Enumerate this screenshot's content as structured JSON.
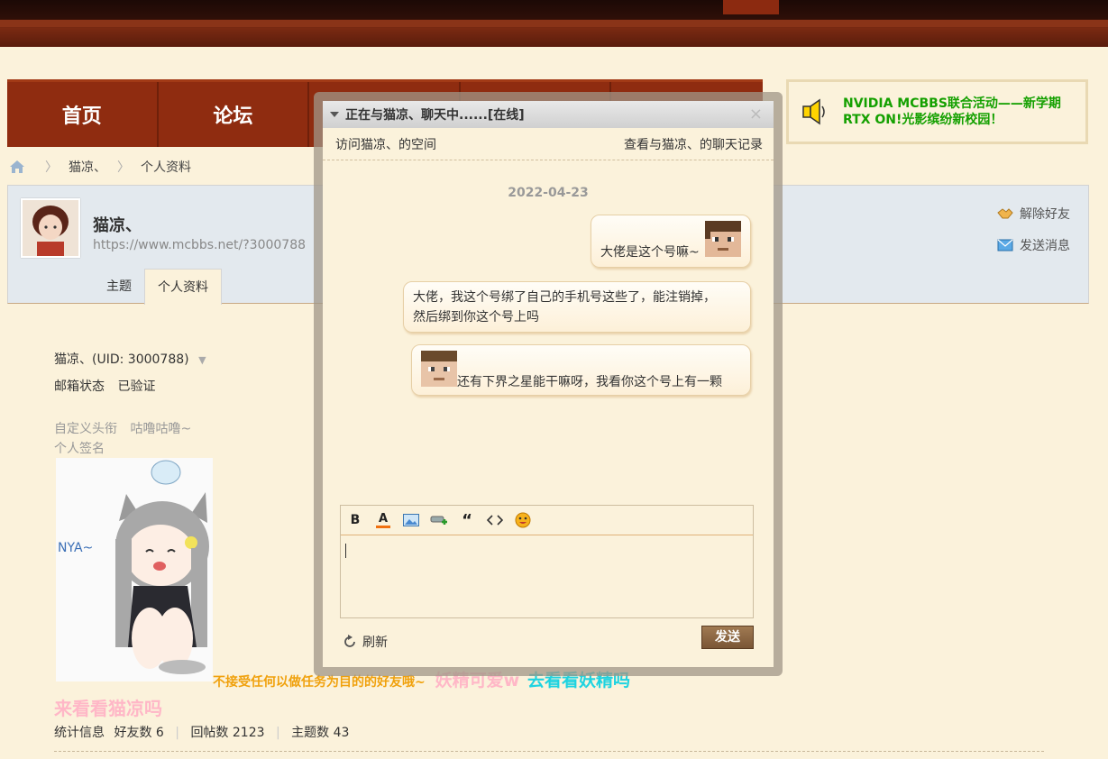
{
  "nav": {
    "items": [
      "首页",
      "论坛",
      "",
      "",
      ""
    ]
  },
  "ad": {
    "line1": "NVIDIA MCBBS联合活动——新学期",
    "line2": "RTX ON!光影缤纷新校园！"
  },
  "breadcrumb": {
    "user": "猫凉、",
    "page": "个人资料"
  },
  "profile": {
    "name": "猫凉、",
    "url": "https://www.mcbbs.net/?3000788",
    "tabs": [
      "主题",
      "个人资料"
    ],
    "actions": {
      "unfriend": "解除好友",
      "message": "发送消息"
    }
  },
  "info": {
    "uid_line": "猫凉、(UID: 3000788)",
    "email_label": "邮箱状态",
    "email_value": "已验证",
    "title_label": "自定义头衔",
    "title_value": "咕噜咕噜~",
    "signature_label": "个人签名",
    "sig_text_a": "不接受任何以做任务为目的的好友哦~",
    "sig_text_b": "妖精可爱w",
    "sig_text_c": "去看看妖精吗",
    "sig_text_d": "来看看猫凉吗",
    "sig_image_text": "NYA~",
    "stats_label": "统计信息",
    "friends": "好友数 6",
    "replies": "回帖数 2123",
    "topics": "主题数 43"
  },
  "chat": {
    "title": "正在与猫凉、聊天中......[在线]",
    "visit_link": "访问猫凉、的空间",
    "history_link": "查看与猫凉、的聊天记录",
    "date": "2022-04-23",
    "messages": [
      {
        "text": "大佬是这个号嘛~"
      },
      {
        "line1": "大佬，我这个号绑了自己的手机号这些了，能注销掉，",
        "line2": "然后绑到你这个号上吗"
      },
      {
        "text": "还有下界之星能干嘛呀，我看你这个号上有一颗"
      }
    ],
    "toolbar": {
      "bold": "B",
      "color": "A",
      "quote": "“"
    },
    "refresh": "刷新",
    "send": "发送",
    "close": "×"
  },
  "colors": {
    "nav_bg": "#8f2c10",
    "ad_text": "#14a000",
    "page_bg": "#fbf2db",
    "send_bg": "#7a5636"
  }
}
